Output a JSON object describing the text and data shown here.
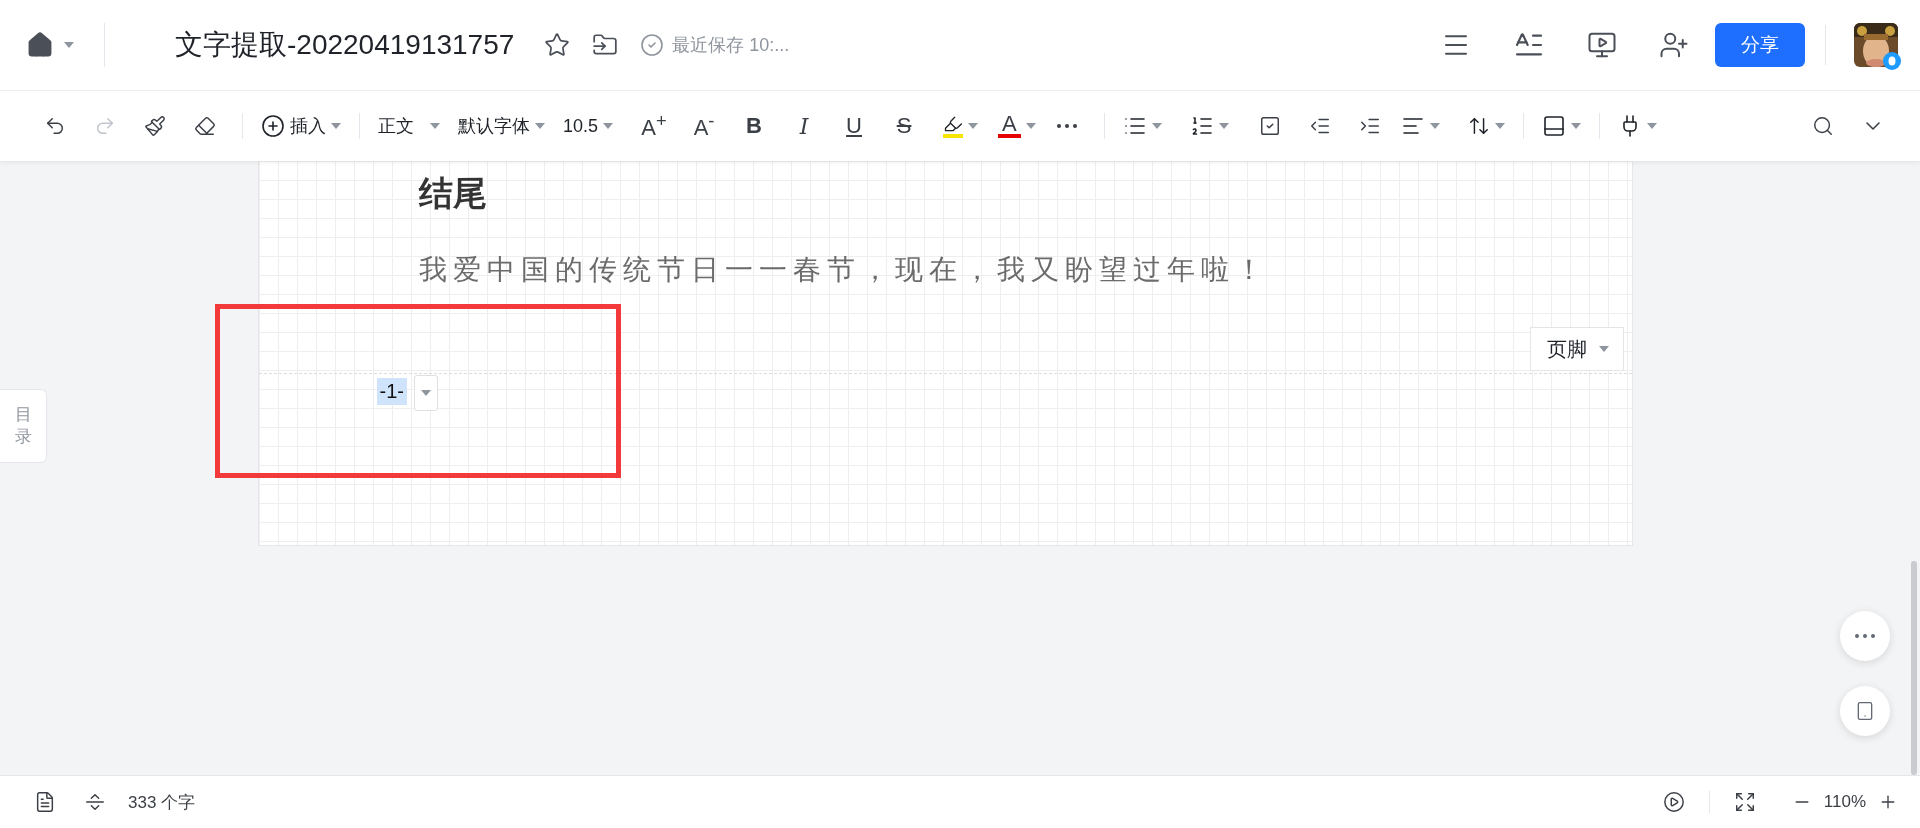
{
  "header": {
    "title": "文字提取-20220419131757",
    "save_status": "最近保存 10:...",
    "share_button": "分享"
  },
  "toolbar": {
    "insert": "插入",
    "style": "正文",
    "font": "默认字体",
    "size": "10.5",
    "font_grow": "A$^{+}$",
    "font_shrink": "A$^{-}$",
    "bold": "B",
    "italic": "I",
    "underline": "U",
    "strikethrough": "S",
    "font_color": "A"
  },
  "outline_tab": [
    "目",
    "录"
  ],
  "document": {
    "heading": "结尾",
    "paragraph": "我爱中国的传统节日一一春节，现在，我又盼望过年啦！",
    "footer_label": "页脚",
    "page_number": "-1-"
  },
  "status_bar": {
    "word_count": "333 个字",
    "zoom": "110%"
  }
}
